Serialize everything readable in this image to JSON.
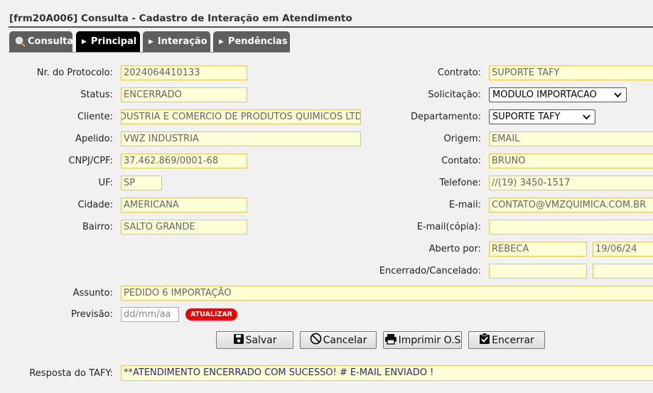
{
  "window": {
    "title": "[frm20A006] Consulta - Cadastro de Interação em Atendimento"
  },
  "tabs": [
    {
      "label": "Consulta",
      "icon": "magnifier-icon"
    },
    {
      "label": "Principal",
      "icon": "triangle-right-icon"
    },
    {
      "label": "Interação",
      "icon": "triangle-right-icon"
    },
    {
      "label": "Pendências",
      "icon": "triangle-right-icon"
    }
  ],
  "form": {
    "protocolo": {
      "label": "Nr. do Protocolo:",
      "value": "2024064410133"
    },
    "status": {
      "label": "Status:",
      "value": "ENCERRADO"
    },
    "cliente": {
      "label": "Cliente:",
      "value": "DUSTRIA E COMERCIO DE PRODUTOS QUIMICOS LTDA"
    },
    "apelido": {
      "label": "Apelido:",
      "value": "VWZ INDUSTRIA"
    },
    "cnpj": {
      "label": "CNPJ/CPF:",
      "value": "37.462.869/0001-68"
    },
    "uf": {
      "label": "UF:",
      "value": "SP"
    },
    "cidade": {
      "label": "Cidade:",
      "value": "AMERICANA"
    },
    "bairro": {
      "label": "Bairro:",
      "value": "SALTO GRANDE"
    },
    "contrato": {
      "label": "Contrato:",
      "value": "SUPORTE TAFY"
    },
    "solicitacao": {
      "label": "Solicitação:",
      "value": "MODULO IMPORTACAO"
    },
    "departamento": {
      "label": "Departamento:",
      "value": "SUPORTE TAFY"
    },
    "origem": {
      "label": "Origem:",
      "value": "EMAIL"
    },
    "contato": {
      "label": "Contato:",
      "value": "BRUNO"
    },
    "telefone": {
      "label": "Telefone:",
      "value": "//(19) 3450-1517"
    },
    "email": {
      "label": "E-mail:",
      "value": "CONTATO@VMZQUIMICA.COM.BR"
    },
    "email_copia": {
      "label": "E-mail(cópia):",
      "value": ""
    },
    "aberto_por": {
      "label": "Aberto por:",
      "value": "REBECA",
      "date": "19/06/24"
    },
    "encerrado": {
      "label": "Encerrado/Cancelado:",
      "value": "",
      "date": ""
    },
    "assunto": {
      "label": "Assunto:",
      "value": "PEDIDO 6 IMPORTAÇÃO"
    },
    "previsao": {
      "label": "Previsão:",
      "placeholder": "dd/mm/aa",
      "badge": "ATUALIZAR"
    },
    "resposta": {
      "label": "Resposta do TAFY:",
      "value": "**ATENDIMENTO ENCERRADO COM SUCESSO! # E-MAIL ENVIADO !"
    }
  },
  "buttons": {
    "salvar": "Salvar",
    "cancelar": "Cancelar",
    "imprimir": "Imprimir O.S",
    "encerrar": "Encerrar"
  },
  "colors": {
    "field_bg": "#ffffd7",
    "field_border": "#e6c65a",
    "badge": "#ee0000",
    "tab_active": "#000000",
    "tab": "#5e5e5e"
  }
}
